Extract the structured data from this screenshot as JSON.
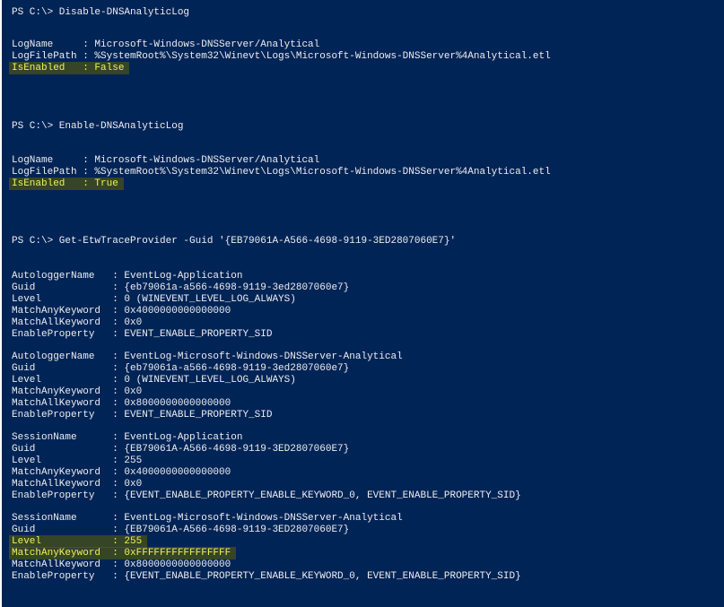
{
  "console": {
    "background": "#012456",
    "text_color": "#eeedf0",
    "highlight_color": "#f0f05a",
    "lines": [
      {
        "text": "PS C:\\> Disable-DNSAnalyticLog",
        "hl": false
      },
      {
        "text": "LogName     : Microsoft-Windows-DNSServer/Analytical",
        "hl": false
      },
      {
        "text": "LogFilePath : %SystemRoot%\\System32\\Winevt\\Logs\\Microsoft-Windows-DNSServer%4Analytical.etl",
        "hl": false
      },
      {
        "text": "IsEnabled   : False",
        "hl": true
      },
      {
        "text": "PS C:\\> Enable-DNSAnalyticLog",
        "hl": false
      },
      {
        "text": "LogName     : Microsoft-Windows-DNSServer/Analytical",
        "hl": false
      },
      {
        "text": "LogFilePath : %SystemRoot%\\System32\\Winevt\\Logs\\Microsoft-Windows-DNSServer%4Analytical.etl",
        "hl": false
      },
      {
        "text": "IsEnabled   : True",
        "hl": true
      },
      {
        "text": "PS C:\\> Get-EtwTraceProvider -Guid '{EB79061A-A566-4698-9119-3ED2807060E7}'",
        "hl": false
      },
      {
        "text": "AutologgerName   : EventLog-Application",
        "hl": false
      },
      {
        "text": "Guid             : {eb79061a-a566-4698-9119-3ed2807060e7}",
        "hl": false
      },
      {
        "text": "Level            : 0 (WINEVENT_LEVEL_LOG_ALWAYS)",
        "hl": false
      },
      {
        "text": "MatchAnyKeyword  : 0x4000000000000000",
        "hl": false
      },
      {
        "text": "MatchAllKeyword  : 0x0",
        "hl": false
      },
      {
        "text": "EnableProperty   : EVENT_ENABLE_PROPERTY_SID",
        "hl": false
      },
      {
        "text": "AutologgerName   : EventLog-Microsoft-Windows-DNSServer-Analytical",
        "hl": false
      },
      {
        "text": "Guid             : {eb79061a-a566-4698-9119-3ed2807060e7}",
        "hl": false
      },
      {
        "text": "Level            : 0 (WINEVENT_LEVEL_LOG_ALWAYS)",
        "hl": false
      },
      {
        "text": "MatchAnyKeyword  : 0x0",
        "hl": false
      },
      {
        "text": "MatchAllKeyword  : 0x8000000000000000",
        "hl": false
      },
      {
        "text": "EnableProperty   : EVENT_ENABLE_PROPERTY_SID",
        "hl": false
      },
      {
        "text": "SessionName      : EventLog-Application",
        "hl": false
      },
      {
        "text": "Guid             : {EB79061A-A566-4698-9119-3ED2807060E7}",
        "hl": false
      },
      {
        "text": "Level            : 255",
        "hl": false
      },
      {
        "text": "MatchAnyKeyword  : 0x4000000000000000",
        "hl": false
      },
      {
        "text": "MatchAllKeyword  : 0x0",
        "hl": false
      },
      {
        "text": "EnableProperty   : {EVENT_ENABLE_PROPERTY_ENABLE_KEYWORD_0, EVENT_ENABLE_PROPERTY_SID}",
        "hl": false
      },
      {
        "text": "SessionName      : EventLog-Microsoft-Windows-DNSServer-Analytical",
        "hl": false
      },
      {
        "text": "Guid             : {EB79061A-A566-4698-9119-3ED2807060E7}",
        "hl": false
      },
      {
        "text": "Level            : 255",
        "hl": true
      },
      {
        "text": "MatchAnyKeyword  : 0xFFFFFFFFFFFFFFFF",
        "hl": true
      },
      {
        "text": "MatchAllKeyword  : 0x8000000000000000",
        "hl": false
      },
      {
        "text": "EnableProperty   : {EVENT_ENABLE_PROPERTY_ENABLE_KEYWORD_0, EVENT_ENABLE_PROPERTY_SID}",
        "hl": false
      }
    ]
  }
}
